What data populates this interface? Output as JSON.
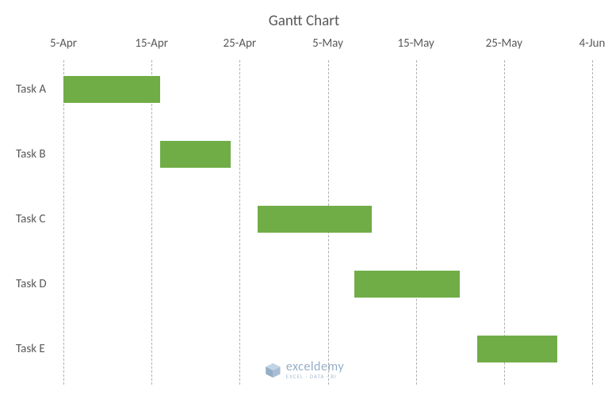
{
  "chart_data": {
    "type": "bar",
    "orientation": "horizontal-gantt",
    "title": "Gantt Chart",
    "x_axis_ticks": [
      "5-Apr",
      "15-Apr",
      "25-Apr",
      "5-May",
      "15-May",
      "25-May",
      "4-Jun"
    ],
    "x_axis_tick_values": [
      0,
      10,
      20,
      30,
      40,
      50,
      60
    ],
    "x_range": [
      0,
      60
    ],
    "categories": [
      "Task A",
      "Task B",
      "Task C",
      "Task D",
      "Task E"
    ],
    "series": [
      {
        "name": "Task A",
        "start": 0,
        "duration": 11
      },
      {
        "name": "Task B",
        "start": 11,
        "duration": 8
      },
      {
        "name": "Task C",
        "start": 22,
        "duration": 13
      },
      {
        "name": "Task D",
        "start": 33,
        "duration": 12
      },
      {
        "name": "Task E",
        "start": 47,
        "duration": 9
      }
    ],
    "bar_color": "#70ad47",
    "grid": true
  },
  "watermark": {
    "brand": "exceldemy",
    "tagline": "EXCEL · DATA · BI"
  }
}
